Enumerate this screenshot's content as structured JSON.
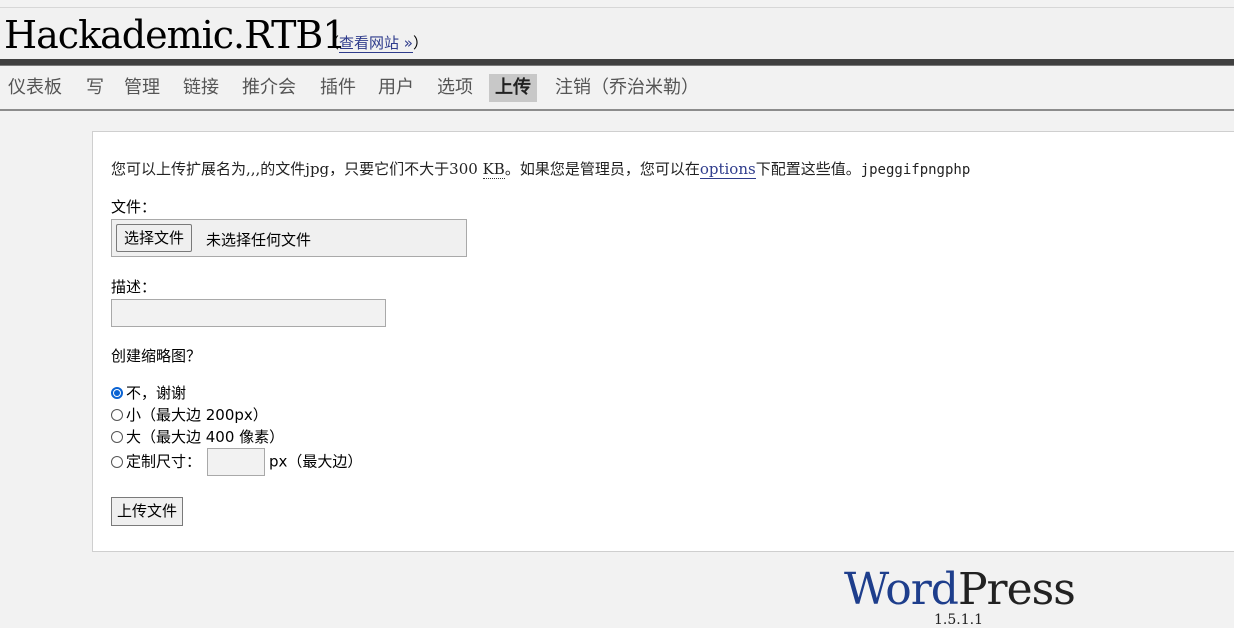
{
  "header": {
    "site_title": "Hackademic.RTB1",
    "visit_site_open": "（",
    "visit_site_link": "查看网站 »",
    "visit_site_close": "）"
  },
  "menu": {
    "items": [
      {
        "label": "仪表板"
      },
      {
        "label": "写"
      },
      {
        "label": "管理"
      },
      {
        "label": "链接"
      },
      {
        "label": "推介会"
      },
      {
        "label": "插件"
      },
      {
        "label": "用户"
      },
      {
        "label": "选项"
      },
      {
        "label": "上传",
        "active": true
      },
      {
        "label": "注销（乔治米勒）"
      }
    ]
  },
  "upload": {
    "info_part1": "您可以上传扩展名为,,,的文件jpg，只要它们不大于300",
    "info_abbr": "KB",
    "info_part2": "。如果您是管理员，您可以在",
    "info_link": "options",
    "info_part3": "下配置这些值。",
    "info_extensions": "jpeggifpngphp",
    "file_label": "文件：",
    "file_button": "选择文件",
    "file_status": "未选择任何文件",
    "description_label": "描述：",
    "description_value": "",
    "thumbnail_label": "创建缩略图？",
    "options": [
      {
        "label": "不，谢谢",
        "checked": true
      },
      {
        "label": "小（最大边 200px）",
        "checked": false
      },
      {
        "label": "大（最大边 400 像素）",
        "checked": false
      }
    ],
    "custom_label": "定制尺寸：",
    "custom_value": "",
    "custom_suffix": "px（最大边）",
    "submit": "上传文件"
  },
  "footer": {
    "logo_word": "Word",
    "logo_press": "Press",
    "version": "1.5.1.1"
  },
  "colors": {
    "link": "#2f3c8c",
    "radio_checked": "#0a63d3",
    "logo_blue": "#1e3e8c"
  }
}
